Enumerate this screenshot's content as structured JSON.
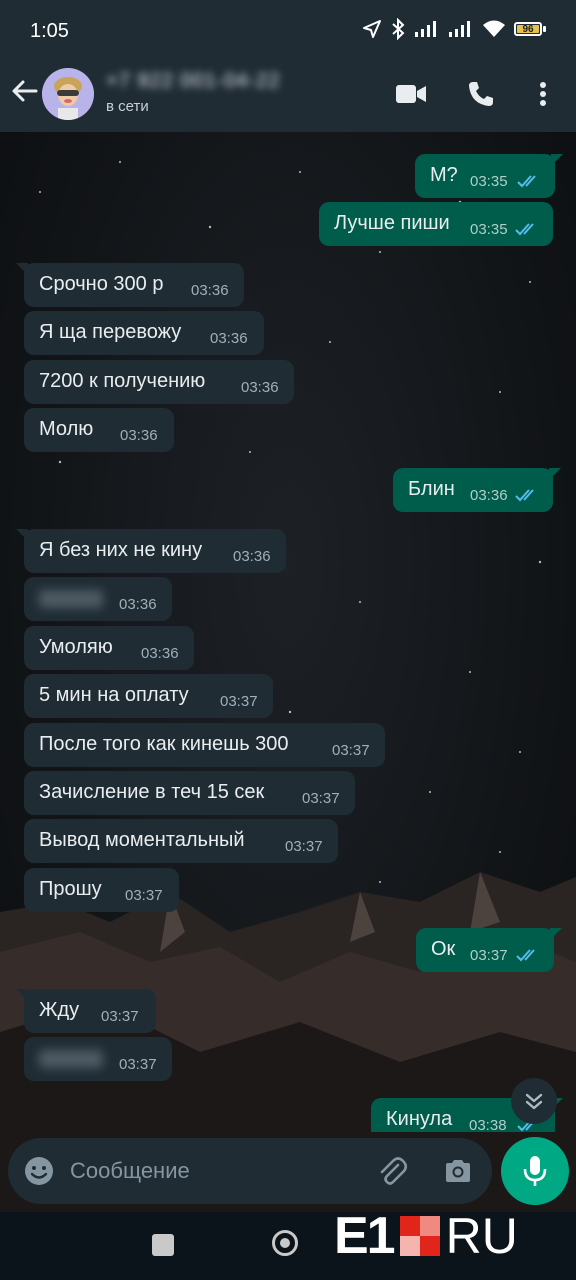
{
  "status_bar": {
    "time": "1:05",
    "battery_level": "96"
  },
  "header": {
    "contact_name": "+7 922 001-04-22",
    "status": "в сети"
  },
  "messages": [
    {
      "dir": "out",
      "text": "М?",
      "time": "03:35",
      "read": true
    },
    {
      "dir": "out",
      "text": "Лучше пиши",
      "time": "03:35",
      "read": true
    },
    {
      "dir": "in",
      "text": "Срочно 300 р",
      "time": "03:36"
    },
    {
      "dir": "in",
      "text": "Я ща перевожу",
      "time": "03:36"
    },
    {
      "dir": "in",
      "text": "7200 к получению",
      "time": "03:36"
    },
    {
      "dir": "in",
      "text": "Молю",
      "time": "03:36"
    },
    {
      "dir": "out",
      "text": "Блин",
      "time": "03:36",
      "read": true
    },
    {
      "dir": "in",
      "text": "Я без них не кину",
      "time": "03:36"
    },
    {
      "dir": "in",
      "text": "",
      "time": "03:36",
      "blurred": true
    },
    {
      "dir": "in",
      "text": "Умоляю",
      "time": "03:36"
    },
    {
      "dir": "in",
      "text": "5 мин на оплату",
      "time": "03:37"
    },
    {
      "dir": "in",
      "text": "После того как кинешь 300",
      "time": "03:37"
    },
    {
      "dir": "in",
      "text": "Зачисление в теч 15 сек",
      "time": "03:37"
    },
    {
      "dir": "in",
      "text": "Вывод моментальный",
      "time": "03:37"
    },
    {
      "dir": "in",
      "text": "Прошу",
      "time": "03:37"
    },
    {
      "dir": "out",
      "text": "Ок",
      "time": "03:37",
      "read": true
    },
    {
      "dir": "in",
      "text": "Жду",
      "time": "03:37"
    },
    {
      "dir": "in",
      "text": "",
      "time": "03:37",
      "blurred": true
    },
    {
      "dir": "out",
      "text": "Кинула",
      "time": "03:38",
      "read": true
    }
  ],
  "composer": {
    "placeholder": "Сообщение"
  },
  "watermark": {
    "left": "E1",
    "right": "RU"
  },
  "colors": {
    "header_bg": "#1f2c34",
    "incoming_bubble": "#1f2c34",
    "outgoing_bubble": "#005c4b",
    "read_ticks": "#53bdeb",
    "mic_button": "#00a884",
    "logo_red": "#e1251b"
  },
  "icons": {
    "back": "arrow-left-icon",
    "video_call": "video-camera-icon",
    "voice_call": "phone-icon",
    "menu": "more-vertical-icon",
    "emoji": "emoji-icon",
    "attach": "paperclip-icon",
    "camera": "camera-icon",
    "mic": "microphone-icon",
    "scroll_down": "double-chevron-down-icon"
  }
}
